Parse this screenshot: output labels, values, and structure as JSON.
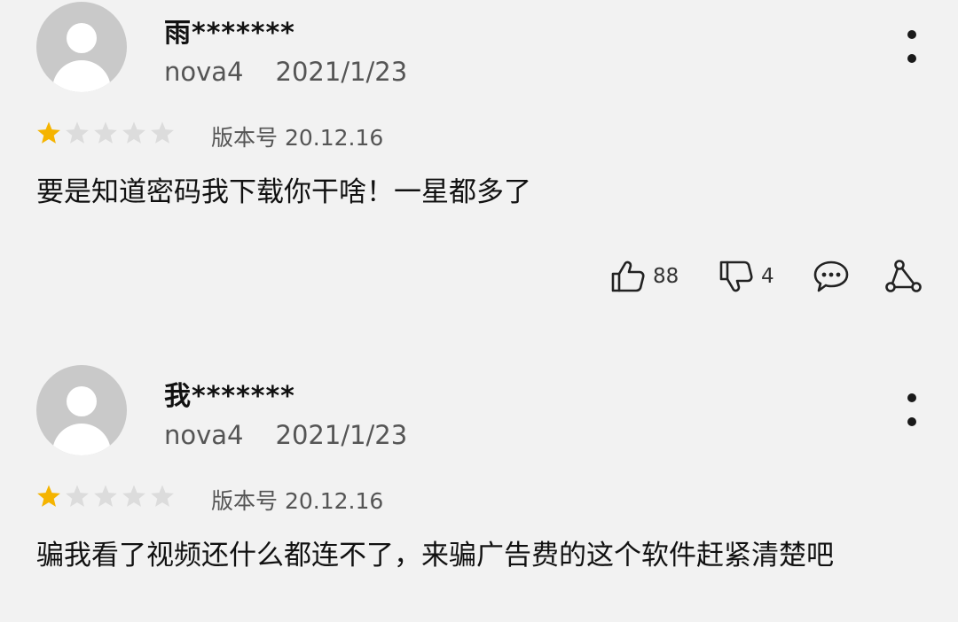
{
  "reviews": [
    {
      "username": "雨*******",
      "device": "nova4",
      "date": "2021/1/23",
      "rating": 1,
      "max_rating": 5,
      "version": "版本号 20.12.16",
      "content": "要是知道密码我下载你干啥！一星都多了",
      "likes": "88",
      "dislikes": "4"
    },
    {
      "username": "我*******",
      "device": "nova4",
      "date": "2021/1/23",
      "rating": 1,
      "max_rating": 5,
      "version": "版本号 20.12.16",
      "content": "骗我看了视频还什么都连不了，来骗广告费的这个软件赶紧清楚吧"
    }
  ],
  "colors": {
    "background": "#f2f2f2",
    "star_filled": "#f5b400",
    "star_empty": "#dcdcdc",
    "avatar": "#c9c9c9"
  }
}
